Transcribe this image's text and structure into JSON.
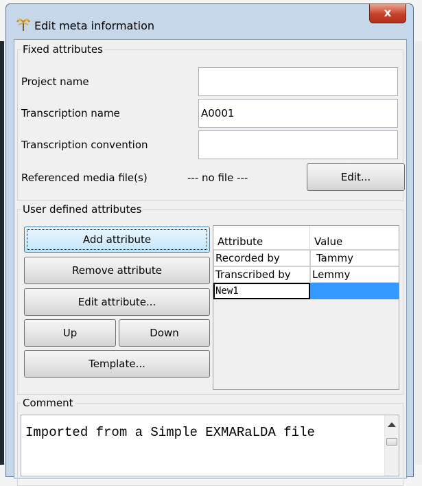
{
  "window": {
    "title": "Edit meta information",
    "close_label": "x",
    "icon": "tree-icon"
  },
  "fixed": {
    "legend": "Fixed attributes",
    "project_name_label": "Project name",
    "project_name_value": "",
    "transcription_name_label": "Transcription name",
    "transcription_name_value": "A0001",
    "transcription_convention_label": "Transcription convention",
    "transcription_convention_value": "",
    "media_label": "Referenced media file(s)",
    "media_value": "--- no file ---",
    "edit_button": "Edit..."
  },
  "user": {
    "legend": "User defined attributes",
    "buttons": {
      "add": "Add attribute",
      "remove": "Remove attribute",
      "edit": "Edit attribute...",
      "up": "Up",
      "down": "Down",
      "template": "Template..."
    },
    "table": {
      "columns": [
        "Attribute",
        "Value"
      ],
      "rows": [
        {
          "attribute": "Recorded by",
          "value": "Tammy"
        },
        {
          "attribute": "Transcribed by",
          "value": "Lemmy"
        },
        {
          "attribute": "New1",
          "value": ""
        }
      ]
    }
  },
  "comment": {
    "legend": "Comment",
    "text": "Imported from a Simple EXMARaLDA file"
  }
}
